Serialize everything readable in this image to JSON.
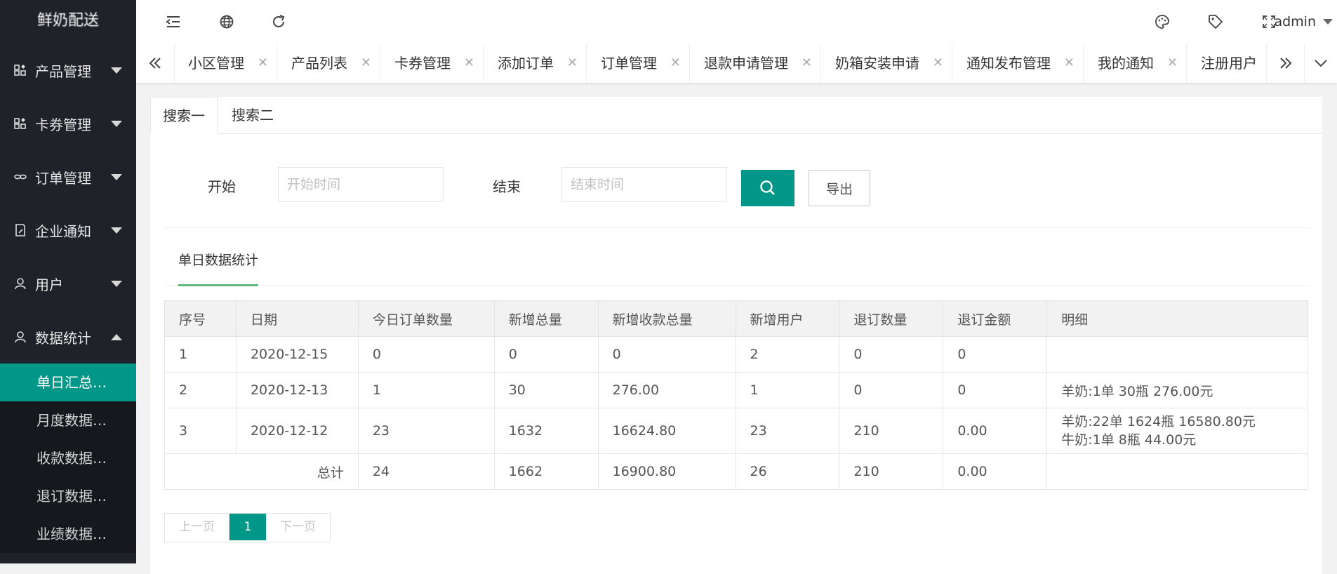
{
  "app": {
    "logo_text": "鲜奶配送"
  },
  "sidebar": {
    "items": [
      {
        "label": "产品管理",
        "icon": "grid-icon",
        "expanded": false
      },
      {
        "label": "卡券管理",
        "icon": "grid-icon",
        "expanded": false
      },
      {
        "label": "订单管理",
        "icon": "link-icon",
        "expanded": false
      },
      {
        "label": "企业通知",
        "icon": "note-icon",
        "expanded": false
      },
      {
        "label": "用户",
        "icon": "user-icon",
        "expanded": false
      },
      {
        "label": "数据统计",
        "icon": "user-icon",
        "expanded": true
      }
    ],
    "subitems": [
      {
        "label": "单日汇总数据",
        "active": true
      },
      {
        "label": "月度数据统计",
        "active": false
      },
      {
        "label": "收款数据统计",
        "active": false
      },
      {
        "label": "退订数据统计",
        "active": false
      },
      {
        "label": "业绩数据统计",
        "active": false
      }
    ]
  },
  "header": {
    "user": "admin",
    "icons": [
      "menu-collapse-icon",
      "globe-icon",
      "refresh-icon",
      "palette-icon",
      "tag-icon",
      "fullscreen-icon"
    ]
  },
  "tabs": [
    {
      "label": "小区管理"
    },
    {
      "label": "产品列表"
    },
    {
      "label": "卡券管理"
    },
    {
      "label": "添加订单"
    },
    {
      "label": "订单管理"
    },
    {
      "label": "退款申请管理"
    },
    {
      "label": "奶箱安装申请"
    },
    {
      "label": "通知发布管理"
    },
    {
      "label": "我的通知"
    },
    {
      "label": "注册用户"
    }
  ],
  "search": {
    "tabs": [
      "搜索一",
      "搜索二"
    ],
    "start_label": "开始",
    "start_placeholder": "开始时间",
    "end_label": "结束",
    "end_placeholder": "结束时间",
    "export_label": "导出"
  },
  "section": {
    "title": "单日数据统计"
  },
  "table": {
    "headers": [
      "序号",
      "日期",
      "今日订单数量",
      "新增总量",
      "新增收款总量",
      "新增用户",
      "退订数量",
      "退订金额",
      "明细"
    ],
    "rows": [
      {
        "idx": "1",
        "date": "2020-12-15",
        "orders": "0",
        "qty": "0",
        "amount": "0",
        "users": "2",
        "refund_qty": "0",
        "refund_amt": "0",
        "detail": []
      },
      {
        "idx": "2",
        "date": "2020-12-13",
        "orders": "1",
        "qty": "30",
        "amount": "276.00",
        "users": "1",
        "refund_qty": "0",
        "refund_amt": "0",
        "detail": [
          "羊奶:1单 30瓶 276.00元"
        ]
      },
      {
        "idx": "3",
        "date": "2020-12-12",
        "orders": "23",
        "qty": "1632",
        "amount": "16624.80",
        "users": "23",
        "refund_qty": "210",
        "refund_amt": "0.00",
        "detail": [
          "羊奶:22单 1624瓶 16580.80元",
          "牛奶:1单 8瓶 44.00元"
        ]
      }
    ],
    "total": {
      "label": "总计",
      "orders": "24",
      "qty": "1662",
      "amount": "16900.80",
      "users": "26",
      "refund_qty": "210",
      "refund_amt": "0.00"
    }
  },
  "pagination": {
    "prev": "上一页",
    "current": "1",
    "next": "下一页"
  },
  "colors": {
    "accent": "#009688",
    "sidebar_bg": "#20222a",
    "underline": "#5FB878"
  }
}
